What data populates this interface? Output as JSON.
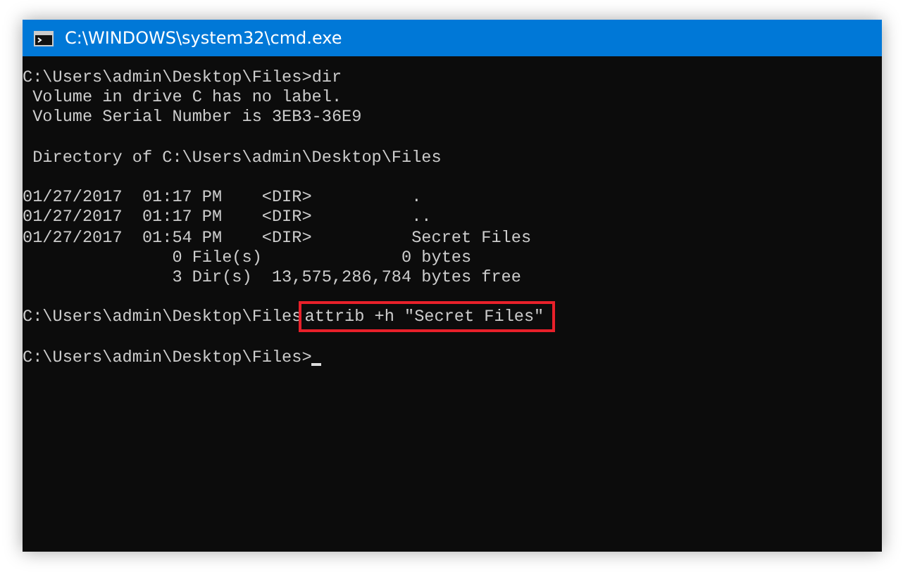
{
  "window": {
    "title": "C:\\WINDOWS\\system32\\cmd.exe"
  },
  "console": {
    "lines": [
      {
        "kind": "command",
        "prompt": "C:\\Users\\admin\\Desktop\\Files>",
        "command": "dir",
        "highlighted": false,
        "cursor": false
      },
      {
        "kind": "output",
        "text": " Volume in drive C has no label."
      },
      {
        "kind": "output",
        "text": " Volume Serial Number is 3EB3-36E9"
      },
      {
        "kind": "blank"
      },
      {
        "kind": "output",
        "text": " Directory of C:\\Users\\admin\\Desktop\\Files"
      },
      {
        "kind": "blank"
      },
      {
        "kind": "output",
        "text": "01/27/2017  01:17 PM    <DIR>          ."
      },
      {
        "kind": "output",
        "text": "01/27/2017  01:17 PM    <DIR>          .."
      },
      {
        "kind": "output",
        "text": "01/27/2017  01:54 PM    <DIR>          Secret Files"
      },
      {
        "kind": "output",
        "text": "               0 File(s)              0 bytes"
      },
      {
        "kind": "output",
        "text": "               3 Dir(s)  13,575,286,784 bytes free"
      },
      {
        "kind": "blank"
      },
      {
        "kind": "command",
        "prompt": "C:\\Users\\admin\\Desktop\\Files",
        "command": "attrib +h \"Secret Files\"",
        "highlighted": true,
        "cursor": false
      },
      {
        "kind": "blank"
      },
      {
        "kind": "command",
        "prompt": "C:\\Users\\admin\\Desktop\\Files>",
        "highlighted": false,
        "cursor": true
      }
    ]
  }
}
